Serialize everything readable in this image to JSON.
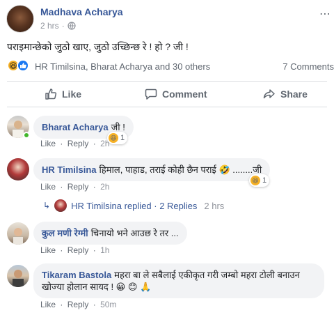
{
  "post": {
    "author": "Madhava Acharya",
    "time": "2 hrs",
    "separator": "·",
    "more_icon": "more-horizontal-icon",
    "text": "पराइमान्छेको जुठो खाए, जुठो उच्छिन्छ रे ! हो ? जी !",
    "reactions_text": "HR Timilsina, Bharat Acharya and 30 others",
    "comment_count": "7 Comments"
  },
  "actions": {
    "like": "Like",
    "comment": "Comment",
    "share": "Share"
  },
  "comments": [
    {
      "name": "Bharat Acharya",
      "text": "जी !",
      "like": "Like",
      "reply": "Reply",
      "time": "2h",
      "reaction_count": "1"
    },
    {
      "name": "HR Timilsina",
      "text": "हिमाल, पाहाड, तराई कोही छैन पराई 🤣 ........जी",
      "like": "Like",
      "reply": "Reply",
      "time": "2h",
      "reaction_count": "1"
    },
    {
      "name": "कुल मणी रेग्मी",
      "text": "चिनायो भने आउछ रे तर ...",
      "like": "Like",
      "reply": "Reply",
      "time": "1h"
    },
    {
      "name": "Tikaram Bastola",
      "text_line1": "महरा बा ले सबैलाई एकीकृत गरी जम्बो महरा टोली बनाउन",
      "text_line2": "खोज्या होलान सायद ! 😀 😊 🙏",
      "like": "Like",
      "reply": "Reply",
      "time": "50m"
    }
  ],
  "replies_summary": {
    "text": "HR Timilsina replied · 2 Replies",
    "time": "2 hrs"
  },
  "dot": "·",
  "colors": {
    "link_blue": "#385898",
    "facebook_blue": "#1877f2",
    "muted_gray": "#606770",
    "bubble_gray": "#f2f3f5",
    "online_green": "#42b72a"
  }
}
